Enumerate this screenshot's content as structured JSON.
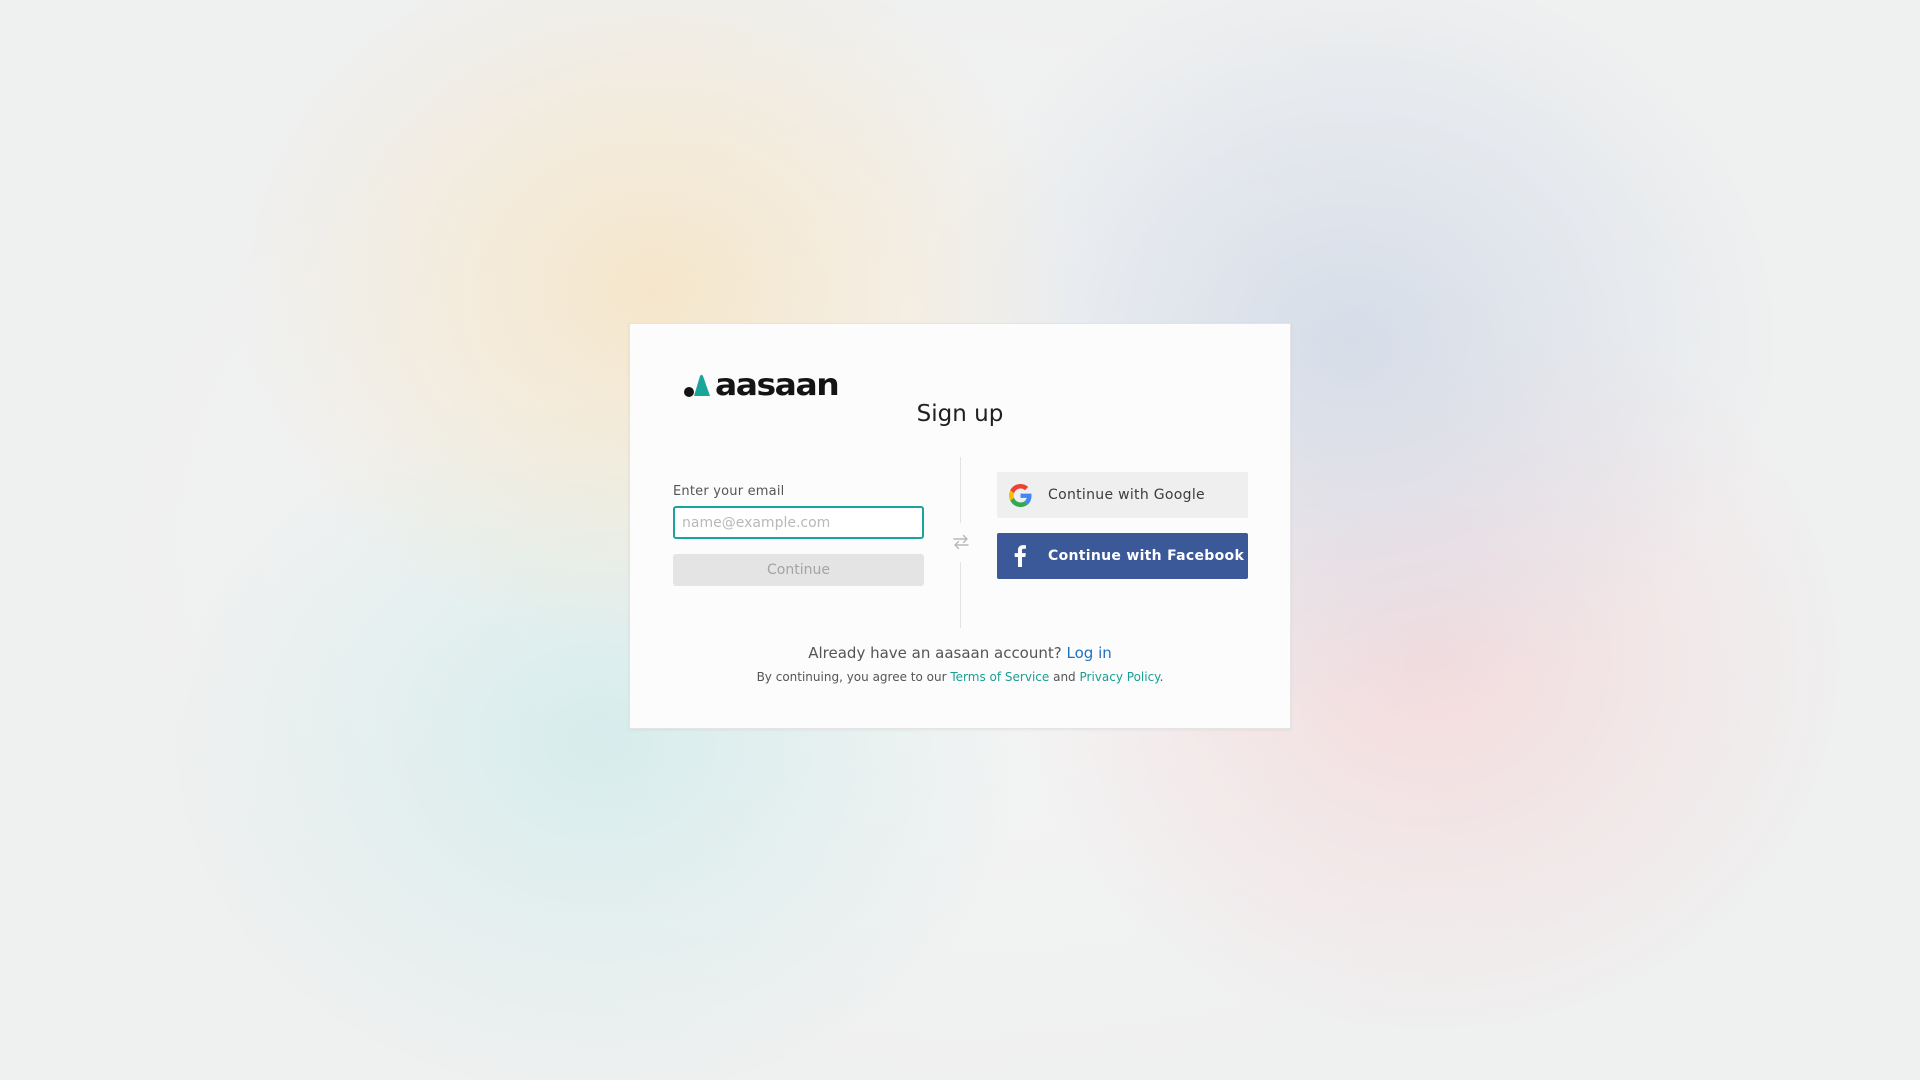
{
  "brand": {
    "name": "aasaan",
    "logo_icon": "aasaan-logo-icon",
    "colors": {
      "accent": "#1aa59a",
      "dark": "#141414"
    }
  },
  "signup": {
    "title": "Sign up",
    "email_label": "Enter your email",
    "email_value": "",
    "email_placeholder": "name@example.com",
    "continue_label": "Continue"
  },
  "divider": {
    "icon": "swap-arrows-icon"
  },
  "social": {
    "google": {
      "label": "Continue with Google",
      "icon": "google-icon"
    },
    "facebook": {
      "label": "Continue with Facebook",
      "icon": "facebook-icon",
      "color": "#3b5998"
    }
  },
  "footer": {
    "login_prompt": "Already have an aasaan account?",
    "login_link": "Log in",
    "terms_prefix": "By continuing, you agree to our",
    "terms_link": "Terms of Service",
    "terms_and": "and",
    "privacy_link": "Privacy Policy",
    "terms_suffix": "."
  }
}
